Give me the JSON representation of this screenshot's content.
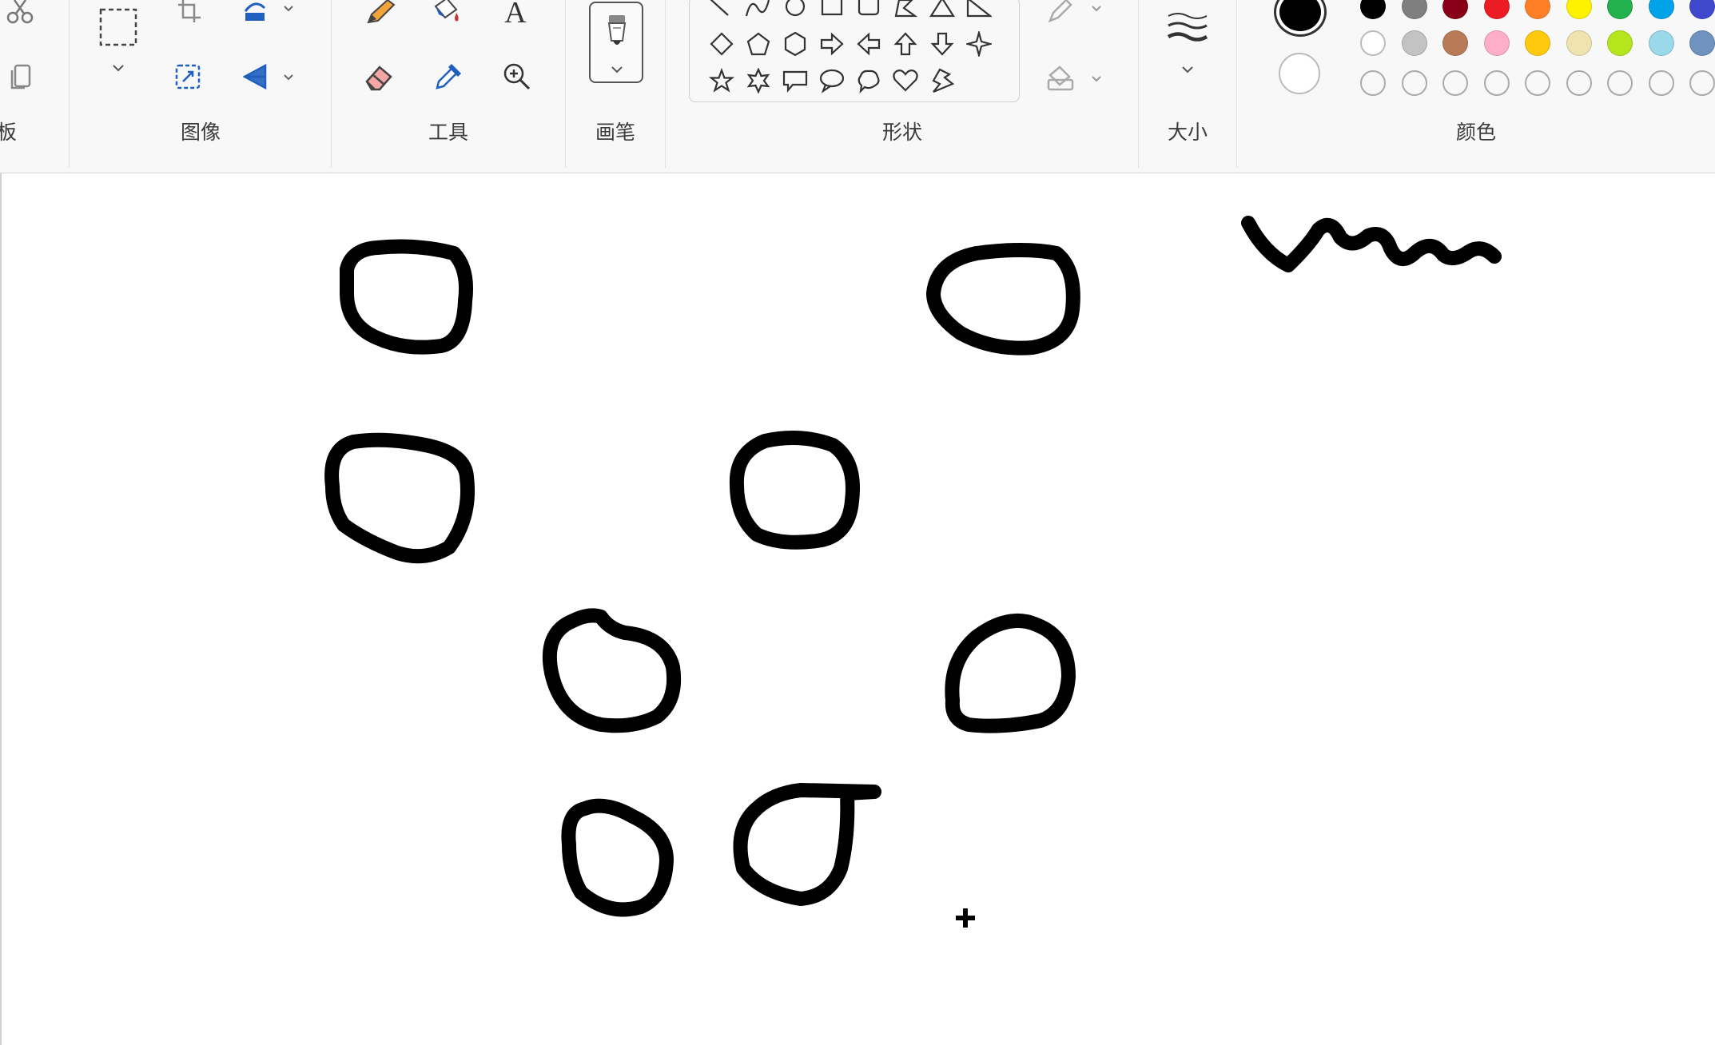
{
  "ribbon": {
    "clipboard": {
      "label_fragment": "板"
    },
    "image": {
      "label": "图像"
    },
    "tools": {
      "label": "工具",
      "text_tool_glyph": "A"
    },
    "brushes": {
      "label": "画笔"
    },
    "shapes": {
      "label": "形状"
    },
    "size": {
      "label": "大小"
    },
    "colors": {
      "label": "颜色",
      "primary": "#000000",
      "secondary": "#ffffff",
      "row1": [
        "#000000",
        "#7f7f7f",
        "#880015",
        "#ed1c24",
        "#ff7f27",
        "#fff200",
        "#22b14c",
        "#00a2e8",
        "#3f48cc"
      ],
      "row2": [
        "#ffffff",
        "#c3c3c3",
        "#b97a57",
        "#ffaec9",
        "#ffc90e",
        "#efe4b0",
        "#b5e61d",
        "#99d9ea",
        "#7092be"
      ]
    }
  },
  "icons": {
    "cut": "scissors-icon",
    "copy": "copy-icon",
    "select": "select-rectangle-icon",
    "crop": "crop-icon",
    "rotate": "rotate-icon",
    "resize": "resize-icon",
    "flip": "flip-icon",
    "pencil": "pencil-icon",
    "fill": "fill-bucket-icon",
    "text": "text-icon",
    "eraser": "eraser-icon",
    "picker": "color-picker-icon",
    "magnifier": "magnifier-icon",
    "brush": "brush-icon",
    "outline": "shape-outline-icon",
    "shape_fill": "shape-fill-icon",
    "size": "line-size-icon",
    "cursor": "crosshair-cursor-icon"
  }
}
